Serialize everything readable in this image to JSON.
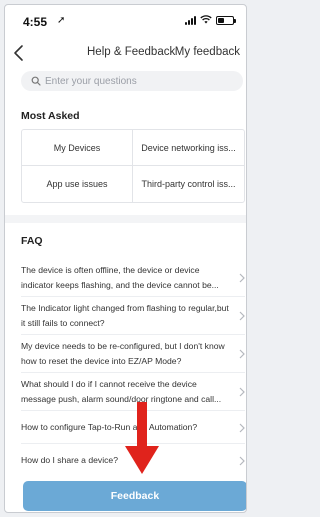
{
  "status_bar": {
    "time": "4:55",
    "location_glyph": "➚",
    "wifi_glyph": "≋",
    "battery_level_pct": 40
  },
  "nav": {
    "title": "Help & Feedback",
    "my_feedback_label": "My feedback"
  },
  "search": {
    "placeholder": "Enter your questions",
    "value": ""
  },
  "most_asked": {
    "title": "Most Asked",
    "items": [
      {
        "label": "My Devices"
      },
      {
        "label": "Device networking iss..."
      },
      {
        "label": "App use issues"
      },
      {
        "label": "Third-party control iss..."
      }
    ]
  },
  "faq": {
    "title": "FAQ",
    "items": [
      {
        "text": "The device is often offline, the device or device indicator keeps flashing, and the device cannot be..."
      },
      {
        "text": "The Indicator light changed from flashing to regular,but it still fails to connect?"
      },
      {
        "text": "My device needs to be re-configured, but I don't know how to reset the device into EZ/AP Mode?"
      },
      {
        "text": "What should I do if I cannot receive the device message push, alarm sound/door ringtone and call..."
      },
      {
        "text": "How to configure Tap-to-Run and Automation?"
      },
      {
        "text": "How do I share a device?"
      }
    ]
  },
  "feedback_button": {
    "label": "Feedback"
  },
  "colors": {
    "accent": "#6ba9d6",
    "annotation_arrow": "#e0231c"
  }
}
